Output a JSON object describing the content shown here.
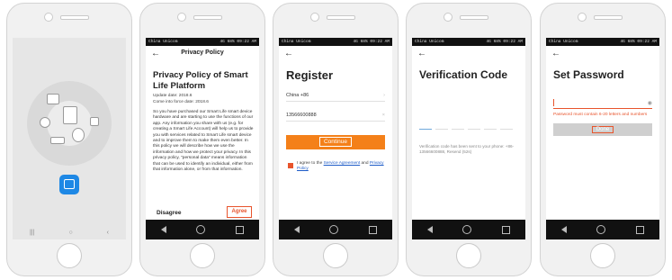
{
  "statusbar": {
    "left": "China Unicom",
    "right": "4G 68% 09:22 AM"
  },
  "splash": {
    "nav_left": "|||",
    "nav_mid": "○",
    "nav_right": "‹"
  },
  "privacy": {
    "header": "Privacy Policy",
    "title": "Privacy Policy of Smart Life Platform",
    "update_date": "Update date: 2018.6",
    "effective_date": "Come into force date: 2018.6",
    "body": "So you have purchased our Smart Life smart device hardware and are starting to use the functions of our app. Any information you share with us (e.g. for creating a Smart Life Account) will help us to provide you with services related to Smart Life smart device and to improve them to make them even better. In this policy we will describe how we use the information and how we protect your privacy. In this privacy policy, \"personal data\" means information that can be used to identify an individual, either from that information alone, or from that information.",
    "disagree": "Disagree",
    "agree": "Agree"
  },
  "register": {
    "title": "Register",
    "country": "China +86",
    "phone": "13566600888",
    "continue": "Continue",
    "agree_prefix": "I agree to the",
    "service_link": "Service Agreement",
    "and": "and",
    "privacy_link": "Privacy Policy"
  },
  "verify": {
    "title": "Verification Code",
    "info": "Verification code has been sent to your phone: +86-13566600888, Resend (52s)"
  },
  "password": {
    "title": "Set Password",
    "eye": "◉",
    "error": "Password must contain 6-20 letters and numbers",
    "done": "Done"
  }
}
